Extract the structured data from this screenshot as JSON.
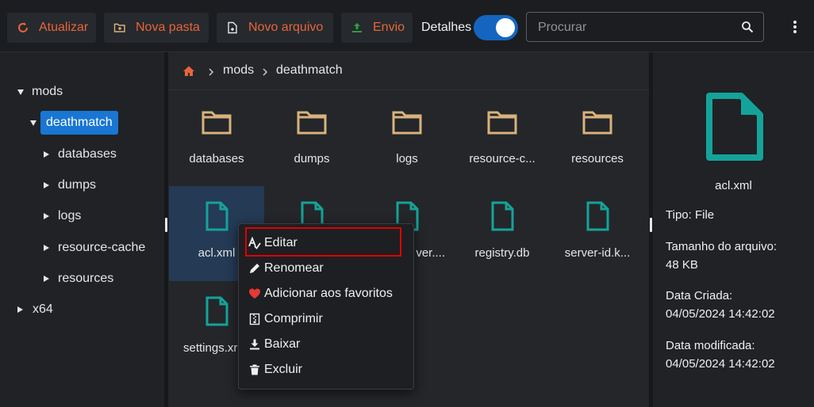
{
  "toolbar": {
    "refresh_label": "Atualizar",
    "new_folder_label": "Nova pasta",
    "new_file_label": "Novo arquivo",
    "upload_label": "Envio",
    "details_label": "Detalhes",
    "details_on": true,
    "search_placeholder": "Procurar"
  },
  "tree": {
    "items": [
      {
        "label": "mods",
        "expanded": true
      },
      {
        "label": "deathmatch",
        "expanded": true,
        "selected": true
      },
      {
        "label": "databases"
      },
      {
        "label": "dumps"
      },
      {
        "label": "logs"
      },
      {
        "label": "resource-cache"
      },
      {
        "label": "resources"
      },
      {
        "label": "x64"
      }
    ]
  },
  "breadcrumb": {
    "items": [
      "mods",
      "deathmatch"
    ]
  },
  "files": [
    {
      "name": "databases",
      "type": "folder"
    },
    {
      "name": "dumps",
      "type": "folder"
    },
    {
      "name": "logs",
      "type": "folder"
    },
    {
      "name": "resource-c...",
      "type": "folder"
    },
    {
      "name": "resources",
      "type": "folder"
    },
    {
      "name": "acl.xml",
      "type": "file",
      "selected": true
    },
    {
      "name": "",
      "type": "file"
    },
    {
      "name": "ver....",
      "type": "file"
    },
    {
      "name": "registry.db",
      "type": "file"
    },
    {
      "name": "server-id.k...",
      "type": "file"
    },
    {
      "name": "settings.xr",
      "type": "file"
    }
  ],
  "details": {
    "name": "acl.xml",
    "type_line": "Tipo: File",
    "size_label": "Tamanho do arquivo:",
    "size_value": "48 KB",
    "created_label": "Data Criada:",
    "created_value": "04/05/2024 14:42:02",
    "modified_label": "Data modificada:",
    "modified_value": "04/05/2024 14:42:02"
  },
  "context_menu": {
    "items": [
      {
        "label": "Editar",
        "icon": "spellcheck-icon"
      },
      {
        "label": "Renomear",
        "icon": "pencil-icon"
      },
      {
        "label": "Adicionar aos favoritos",
        "icon": "heart-icon"
      },
      {
        "label": "Comprimir",
        "icon": "archive-icon"
      },
      {
        "label": "Baixar",
        "icon": "download-icon"
      },
      {
        "label": "Excluir",
        "icon": "trash-icon"
      }
    ]
  },
  "colors": {
    "accent_orange": "#e8643a",
    "folder": "#d9b27c",
    "file": "#14a39a",
    "selection": "#1976d2",
    "highlight_box": "#e00000",
    "heart": "#e53935"
  }
}
